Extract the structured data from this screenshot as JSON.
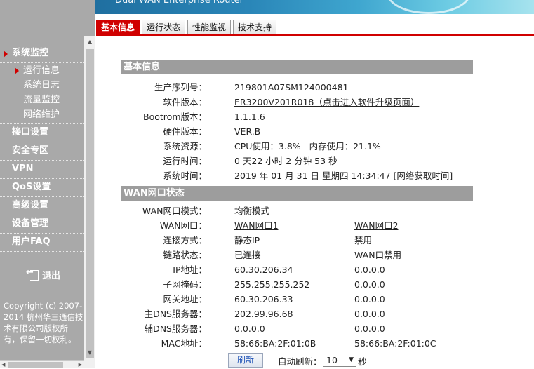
{
  "banner": {
    "title": "Dual WAN Enterprise Router"
  },
  "tabs": [
    {
      "label": "基本信息",
      "active": true
    },
    {
      "label": "运行状态",
      "active": false
    },
    {
      "label": "性能监视",
      "active": false
    },
    {
      "label": "技术支持",
      "active": false
    }
  ],
  "sidebar": {
    "menu_system": "系统监控",
    "sub_running": "运行信息",
    "sub_log": "系统日志",
    "sub_traffic": "流量监控",
    "sub_network": "网络维护",
    "menu_interface": "接口设置",
    "menu_security": "安全专区",
    "menu_vpn": "VPN",
    "menu_qos": "QoS设置",
    "menu_advanced": "高级设置",
    "menu_device": "设备管理",
    "menu_faq": "用户FAQ",
    "logout": "退出",
    "copyright": "Copyright (c) 2007-2014 杭州华三通信技术有限公司版权所有，保留一切权利。"
  },
  "basic": {
    "heading": "基本信息",
    "serial_label": "生产序列号：",
    "serial": "219801A07SM124000481",
    "software_label": "软件版本：",
    "software": "ER3200V201R018（点击进入软件升级页面）",
    "bootrom_label": "Bootrom版本：",
    "bootrom": "1.1.1.6",
    "hardware_label": "硬件版本：",
    "hardware": "VER.B",
    "resource_label": "系统资源：",
    "resource": "CPU使用：3.8%   内存使用：21.1%",
    "uptime_label": "运行时间：",
    "uptime": "0 天22 小时 2 分钟 53 秒",
    "systime_label": "系统时间：",
    "systime": "2019 年 01 月 31 日 星期四 14:34:47 [网络获取时间]"
  },
  "wan": {
    "heading": "WAN网口状态",
    "mode_label": "WAN网口模式：",
    "mode": "均衡模式",
    "port_label": "WAN网口：",
    "port1": "WAN网口1",
    "port2": "WAN网口2",
    "conn_label": "连接方式：",
    "conn1": "静态IP",
    "conn2": "禁用",
    "link_label": "链路状态：",
    "link1": "已连接",
    "link2": "WAN口禁用",
    "ip_label": "IP地址：",
    "ip1": "60.30.206.34",
    "ip2": "0.0.0.0",
    "mask_label": "子网掩码：",
    "mask1": "255.255.255.252",
    "mask2": "0.0.0.0",
    "gw_label": "网关地址：",
    "gw1": "60.30.206.33",
    "gw2": "0.0.0.0",
    "dns1_label": "主DNS服务器：",
    "dns1_1": "202.99.96.68",
    "dns1_2": "0.0.0.0",
    "dns2_label": "辅DNS服务器：",
    "dns2_1": "0.0.0.0",
    "dns2_2": "0.0.0.0",
    "mac_label": "MAC地址：",
    "mac1": "58:66:BA:2F:01:0B",
    "mac2": "58:66:BA:2F:01:0C"
  },
  "controls": {
    "refresh": "刷新",
    "auto_refresh_label": "自动刷新：",
    "interval": "10",
    "unit": "秒"
  },
  "colors": {
    "accent": "#d00000",
    "sidebar": "#a9a9a9",
    "section": "#9d9d9d",
    "link": "#1a4fb5"
  }
}
